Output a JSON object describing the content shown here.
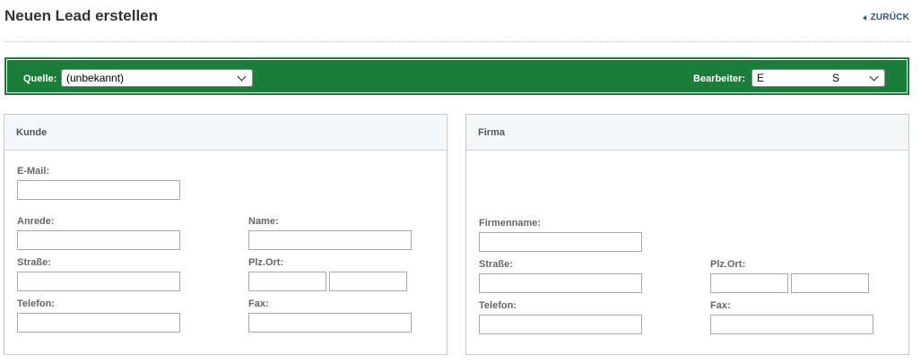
{
  "header": {
    "title": "Neuen Lead erstellen",
    "back_label": "ZURÜCK"
  },
  "toolbar": {
    "source_label": "Quelle:",
    "source_value": "(unbekannt)",
    "assignee_label": "Bearbeiter:",
    "assignee_value_start": "E",
    "assignee_value_end": "S"
  },
  "kunde": {
    "title": "Kunde",
    "email_label": "E-Mail:",
    "salutation_label": "Anrede:",
    "name_label": "Name:",
    "street_label": "Straße:",
    "zipcity_label": "Plz.Ort:",
    "phone_label": "Telefon:",
    "fax_label": "Fax:"
  },
  "firma": {
    "title": "Firma",
    "company_label": "Firmenname:",
    "street_label": "Straße:",
    "zipcity_label": "Plz.Ort:",
    "phone_label": "Telefon:",
    "fax_label": "Fax:"
  },
  "colors": {
    "accent_green": "#1b7d3a",
    "link_blue": "#2a5587"
  },
  "icons": {
    "back": "caret-left-icon",
    "dropdown": "chevron-down-icon"
  }
}
